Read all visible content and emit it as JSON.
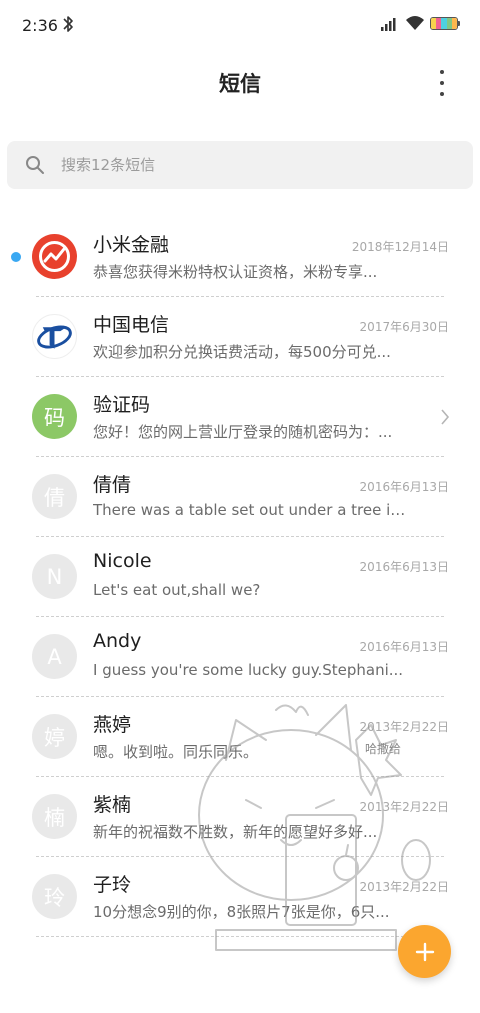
{
  "status_bar": {
    "time": "2:36",
    "battery_colors": [
      "#f7d34c",
      "#f06292",
      "#4dd0e1",
      "#81c784",
      "#ffb74d"
    ]
  },
  "header": {
    "title": "短信",
    "more_icon": "more-vertical-icon"
  },
  "search": {
    "placeholder": "搜索12条短信",
    "icon": "search-icon"
  },
  "accent": {
    "unread": "#3aa8f2",
    "fab": "#fba62f",
    "verify_avatar": "#8cc866",
    "mi_avatar": "#e8412d",
    "telecom_avatar": "#1a4fa0"
  },
  "conversations": [
    {
      "name": "小米金融",
      "date": "2018年12月14日",
      "preview": "恭喜您获得米粉特权认证资格，米粉专享...",
      "avatar": "mi-finance-logo",
      "unread": true
    },
    {
      "name": "中国电信",
      "date": "2017年6月30日",
      "preview": "欢迎参加积分兑换话费活动，每500分可兑...",
      "avatar": "china-telecom-logo"
    },
    {
      "name": "验证码",
      "date": "",
      "preview": "您好！您的网上营业厅登录的随机密码为：...",
      "avatar_char": "码",
      "has_chevron": true
    },
    {
      "name": "倩倩",
      "date": "2016年6月13日",
      "preview": "There was a table set out under a tree in...",
      "avatar_char": "倩"
    },
    {
      "name": "Nicole",
      "date": "2016年6月13日",
      "preview": "Let's eat out,shall we?",
      "avatar_char": "N"
    },
    {
      "name": "Andy",
      "date": "2016年6月13日",
      "preview": "I guess you're some lucky guy.Stephani...",
      "avatar_char": "A"
    },
    {
      "name": "燕婷",
      "date": "2013年2月22日",
      "preview": "嗯。收到啦。同乐同乐。",
      "avatar_char": "婷"
    },
    {
      "name": "紫楠",
      "date": "2013年2月22日",
      "preview": "新年的祝福数不胜数，新年的愿望好多好...",
      "avatar_char": "楠"
    },
    {
      "name": "子玲",
      "date": "2013年2月22日",
      "preview": "10分想念9别的你，8张照片7张是你，6只...",
      "avatar_char": "玲"
    }
  ],
  "watermark": {
    "text": "哈撒给"
  },
  "fab": {
    "icon": "plus-icon"
  }
}
